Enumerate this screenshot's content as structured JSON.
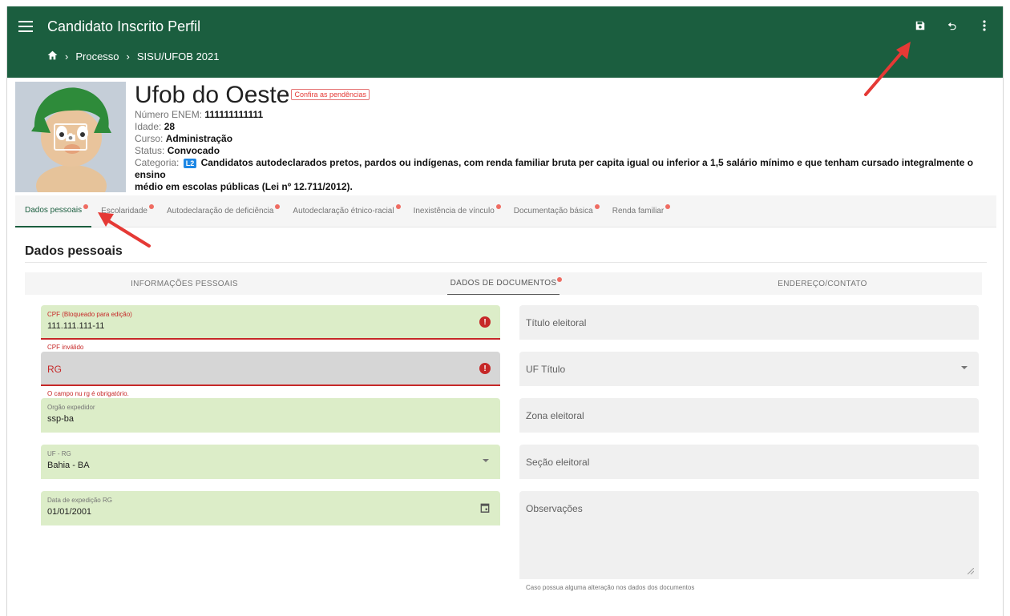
{
  "appbar": {
    "title": "Candidato Inscrito Perfil",
    "breadcrumb": [
      "Processo",
      "SISU/UFOB 2021"
    ],
    "icons": [
      "menu-icon",
      "home-icon",
      "save-icon",
      "undo-icon",
      "more-vert-icon"
    ]
  },
  "profile": {
    "name": "Ufob do Oeste",
    "pending_badge": "Confira as pendências",
    "enem_label": "Número ENEM:",
    "enem_value": "111111111111",
    "idade_label": "Idade:",
    "idade_value": "28",
    "curso_label": "Curso:",
    "curso_value": "Administração",
    "status_label": "Status:",
    "status_value": "Convocado",
    "categoria_label": "Categoria:",
    "categoria_badge": "L2",
    "categoria_line1": "Candidatos autodeclarados pretos, pardos ou indígenas, com renda familiar bruta per capita igual ou inferior a 1,5 salário mínimo e que tenham cursado integralmente o ensino",
    "categoria_line2": "médio em escolas públicas (Lei nº 12.711/2012)."
  },
  "tabs": [
    {
      "label": "Dados pessoais",
      "active": true
    },
    {
      "label": "Escolaridade"
    },
    {
      "label": "Autodeclaração de deficiência"
    },
    {
      "label": "Autodeclaração étnico-racial"
    },
    {
      "label": "Inexistência de vínculo"
    },
    {
      "label": "Documentação básica"
    },
    {
      "label": "Renda familiar"
    }
  ],
  "section": {
    "title": "Dados pessoais",
    "subtabs": [
      "INFORMAÇÕES PESSOAIS",
      "DADOS DE DOCUMENTOS",
      "ENDEREÇO/CONTATO"
    ]
  },
  "form": {
    "cpf_label": "CPF (Bloqueado para edição)",
    "cpf_value": "111.111.111-11",
    "cpf_error": "CPF inválido",
    "rg_placeholder": "RG",
    "rg_error": "O campo nu rg é obrigatório.",
    "orgao_label": "Orgão expedidor",
    "orgao_value": "ssp-ba",
    "uf_rg_label": "UF - RG",
    "uf_rg_value": "Bahia - BA",
    "data_exp_label": "Data de expedição RG",
    "data_exp_value": "01/01/2001",
    "titulo_placeholder": "Título eleitoral",
    "uf_titulo_placeholder": "UF Título",
    "zona_placeholder": "Zona eleitoral",
    "secao_placeholder": "Seção eleitoral",
    "obs_placeholder": "Observações",
    "obs_hint": "Caso possua alguma alteração nos dados dos documentos"
  },
  "colors": {
    "appbar": "#1b5e3f",
    "field_valid": "#dcedc8",
    "error": "#c62828",
    "annotation_arrow": "#e53935"
  }
}
